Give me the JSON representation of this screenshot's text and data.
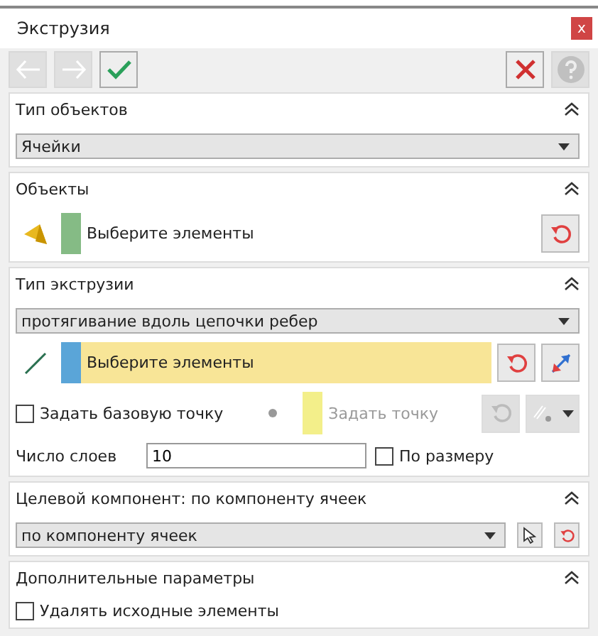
{
  "window": {
    "title": "Экструзия",
    "close": "x"
  },
  "toolbar": {
    "left": [
      {
        "kind": "back",
        "disabled": true
      },
      {
        "kind": "forward",
        "disabled": true
      },
      {
        "kind": "ok",
        "disabled": false
      }
    ],
    "right": [
      {
        "kind": "cancel",
        "disabled": false
      },
      {
        "kind": "help",
        "disabled": true
      }
    ]
  },
  "sections": [
    {
      "kind": "type",
      "title": "Тип объектов",
      "expanded": true,
      "dropdown": "Ячейки"
    },
    {
      "kind": "objects",
      "title": "Объекты",
      "expanded": true,
      "selector": {
        "placeholder": "Выберите элементы",
        "color": "#85bb85",
        "active": false
      }
    },
    {
      "kind": "extrusion",
      "title": "Тип экструзии",
      "expanded": true,
      "dropdown": "протягивание вдоль цепочки ребер",
      "selector": {
        "placeholder": "Выберите элементы",
        "color": "#5aa5d8",
        "active": true
      },
      "base_point": {
        "label": "Задать базовую точку",
        "checked": false,
        "placeholder": "Задать точку",
        "disabled": true
      },
      "layers": {
        "label": "Число слоев",
        "value": "10",
        "by_size": {
          "label": "По размеру",
          "checked": false
        }
      }
    },
    {
      "kind": "target",
      "title": "Целевой компонент: по компоненту ячеек",
      "expanded": true,
      "dropdown": "по компоненту ячеек"
    },
    {
      "kind": "extra",
      "title": "Дополнительные параметры",
      "expanded": true,
      "checkbox": {
        "label": "Удалять исходные элементы",
        "checked": false
      }
    }
  ]
}
